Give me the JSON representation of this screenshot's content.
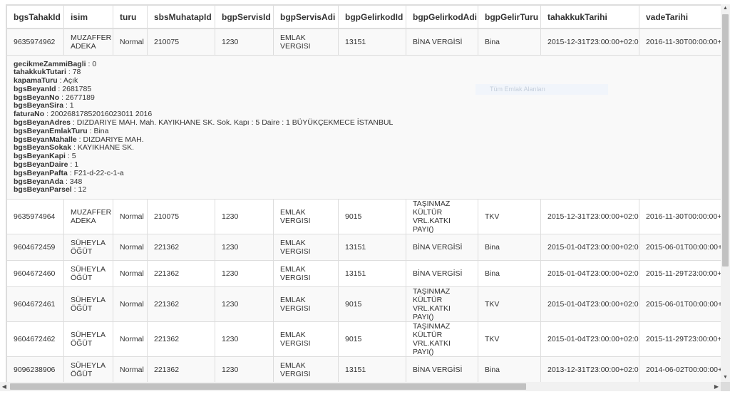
{
  "grid": {
    "columns": [
      "bgsTahakId",
      "isim",
      "turu",
      "sbsMuhatapId",
      "bgpServisId",
      "bgpServisAdi",
      "bgpGelirkodId",
      "bgpGelirkodAdi",
      "bgpGelirTuru",
      "tahakkukTarihi",
      "vadeTarihi"
    ],
    "rows": [
      {
        "bgsTahakId": "9635974962",
        "isim": "MUZAFFER ADEKA",
        "turu": "Normal",
        "sbsMuhatapId": "210075",
        "bgpServisId": "1230",
        "bgpServisAdi": "EMLAK VERGISI",
        "bgpGelirkodId": "13151",
        "bgpGelirkodAdi": "BİNA VERGİSİ",
        "bgpGelirTuru": "Bina",
        "tahakkukTarihi": "2015-12-31T23:00:00+02:00",
        "vadeTarihi": "2016-11-30T00:00:00+03"
      },
      {
        "bgsTahakId": "9635974964",
        "isim": "MUZAFFER ADEKA",
        "turu": "Normal",
        "sbsMuhatapId": "210075",
        "bgpServisId": "1230",
        "bgpServisAdi": "EMLAK VERGISI",
        "bgpGelirkodId": "9015",
        "bgpGelirkodAdi": "TAŞINMAZ KÜLTÜR VRL.KATKI PAYI()",
        "bgpGelirTuru": "TKV",
        "tahakkukTarihi": "2015-12-31T23:00:00+02:00",
        "vadeTarihi": "2016-11-30T00:00:00+03"
      },
      {
        "bgsTahakId": "9604672459",
        "isim": "SÜHEYLA ÖĞÜT",
        "turu": "Normal",
        "sbsMuhatapId": "221362",
        "bgpServisId": "1230",
        "bgpServisAdi": "EMLAK VERGISI",
        "bgpGelirkodId": "13151",
        "bgpGelirkodAdi": "BİNA VERGİSİ",
        "bgpGelirTuru": "Bina",
        "tahakkukTarihi": "2015-01-04T23:00:00+02:00",
        "vadeTarihi": "2015-06-01T00:00:00+03"
      },
      {
        "bgsTahakId": "9604672460",
        "isim": "SÜHEYLA ÖĞÜT",
        "turu": "Normal",
        "sbsMuhatapId": "221362",
        "bgpServisId": "1230",
        "bgpServisAdi": "EMLAK VERGISI",
        "bgpGelirkodId": "13151",
        "bgpGelirkodAdi": "BİNA VERGİSİ",
        "bgpGelirTuru": "Bina",
        "tahakkukTarihi": "2015-01-04T23:00:00+02:00",
        "vadeTarihi": "2015-11-29T23:00:00+02"
      },
      {
        "bgsTahakId": "9604672461",
        "isim": "SÜHEYLA ÖĞÜT",
        "turu": "Normal",
        "sbsMuhatapId": "221362",
        "bgpServisId": "1230",
        "bgpServisAdi": "EMLAK VERGISI",
        "bgpGelirkodId": "9015",
        "bgpGelirkodAdi": "TAŞINMAZ KÜLTÜR VRL.KATKI PAYI()",
        "bgpGelirTuru": "TKV",
        "tahakkukTarihi": "2015-01-04T23:00:00+02:00",
        "vadeTarihi": "2015-06-01T00:00:00+03"
      },
      {
        "bgsTahakId": "9604672462",
        "isim": "SÜHEYLA ÖĞÜT",
        "turu": "Normal",
        "sbsMuhatapId": "221362",
        "bgpServisId": "1230",
        "bgpServisAdi": "EMLAK VERGISI",
        "bgpGelirkodId": "9015",
        "bgpGelirkodAdi": "TAŞINMAZ KÜLTÜR VRL.KATKI PAYI()",
        "bgpGelirTuru": "TKV",
        "tahakkukTarihi": "2015-01-04T23:00:00+02:00",
        "vadeTarihi": "2015-11-29T23:00:00+02"
      },
      {
        "bgsTahakId": "9096238906",
        "isim": "SÜHEYLA ÖĞÜT",
        "turu": "Normal",
        "sbsMuhatapId": "221362",
        "bgpServisId": "1230",
        "bgpServisAdi": "EMLAK VERGISI",
        "bgpGelirkodId": "13151",
        "bgpGelirkodAdi": "BİNA VERGİSİ",
        "bgpGelirTuru": "Bina",
        "tahakkukTarihi": "2013-12-31T23:00:00+02:00",
        "vadeTarihi": "2014-06-02T00:00:00+03"
      }
    ],
    "detail": [
      {
        "key": "gecikmeZammiBagli",
        "value": "0"
      },
      {
        "key": "tahakkukTutari",
        "value": "78"
      },
      {
        "key": "kapamaTuru",
        "value": "Açık"
      },
      {
        "key": "bgsBeyanId",
        "value": "2681785"
      },
      {
        "key": "bgsBeyanNo",
        "value": "2677189"
      },
      {
        "key": "bgsBeyanSira",
        "value": "1"
      },
      {
        "key": "faturaNo",
        "value": "20026817852016023011 2016"
      },
      {
        "key": "bgsBeyanAdres",
        "value": "DIZDARIYE MAH. Mah. KAYIKHANE SK. Sok. Kapı : 5 Daire : 1 BÜYÜKÇEKMECE İSTANBUL"
      },
      {
        "key": "bgsBeyanEmlakTuru",
        "value": "Bina"
      },
      {
        "key": "bgsBeyanMahalle",
        "value": "DIZDARIYE MAH."
      },
      {
        "key": "bgsBeyanSokak",
        "value": "KAYIKHANE SK."
      },
      {
        "key": "bgsBeyanKapi",
        "value": "5"
      },
      {
        "key": "bgsBeyanDaire",
        "value": "1"
      },
      {
        "key": "bgsBeyanPafta",
        "value": "F21-d-22-c-1-a"
      },
      {
        "key": "bgsBeyanAda",
        "value": "348"
      },
      {
        "key": "bgsBeyanParsel",
        "value": "12"
      }
    ]
  },
  "ghost_tooltip": "Tüm Emlak Alanları",
  "scrollbar": {
    "arrow_up": "▲",
    "arrow_down": "▼",
    "arrow_left": "◀",
    "arrow_right": "▶"
  }
}
